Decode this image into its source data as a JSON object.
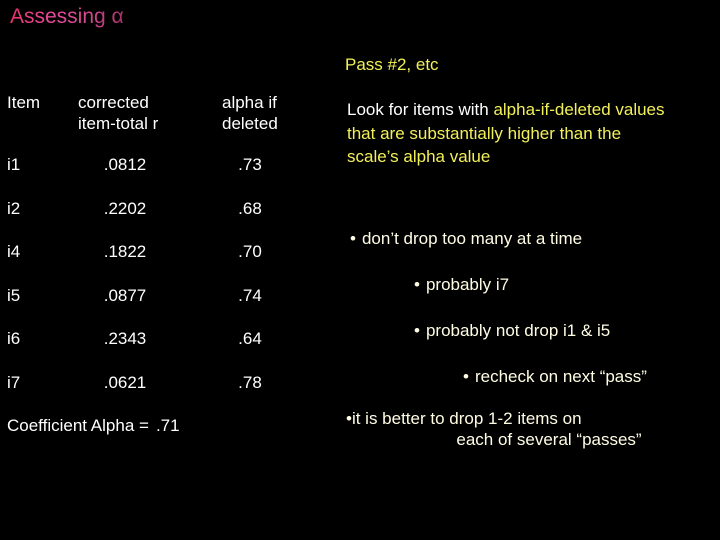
{
  "slide": {
    "background_color": "#000000",
    "title": "Assessing α",
    "title_gradient": [
      "#e8316e",
      "#e8499a",
      "#d64a92",
      "#a8336b"
    ]
  },
  "table": {
    "headers": {
      "item": "Item",
      "corrected_line1": "corrected",
      "corrected_line2": "item-total r",
      "alpha_line1": "alpha if",
      "alpha_line2": "deleted"
    },
    "rows": [
      {
        "item": "i1",
        "corrected": ".0812",
        "alpha_if_deleted": ".73"
      },
      {
        "item": "i2",
        "corrected": ".2202",
        "alpha_if_deleted": ".68"
      },
      {
        "item": "i4",
        "corrected": ".1822",
        "alpha_if_deleted": ".70"
      },
      {
        "item": "i5",
        "corrected": ".0877",
        "alpha_if_deleted": ".74"
      },
      {
        "item": "i6",
        "corrected": ".2343",
        "alpha_if_deleted": ".64"
      },
      {
        "item": "i7",
        "corrected": ".0621",
        "alpha_if_deleted": ".78"
      }
    ],
    "footer_label": "Coefficient Alpha =",
    "footer_value": ".71",
    "text_color": "#ffffff"
  },
  "right_panel": {
    "heading": "Pass #2, etc",
    "heading_color": "#f2f05a",
    "paragraph_lead": "Look for items with ",
    "paragraph_emphasis": "alpha-if-deleted values that are substantially higher than the scale’s alpha value",
    "paragraph_lead_color": "#ffffff",
    "paragraph_emphasis_color": "#f2f05a",
    "bullet_color": "#fffde4",
    "bullets": [
      {
        "marker": "•",
        "text": "don’t drop too many at a time",
        "level": 1
      },
      {
        "marker": "•",
        "text": "probably i7",
        "level": 2
      },
      {
        "marker": "•",
        "text": "probably not drop i1 & i5",
        "level": 2
      },
      {
        "marker": "•",
        "text": "recheck on next “pass”",
        "level": 3
      },
      {
        "marker": "•",
        "text_line1": "it is better to drop 1-2 items on",
        "text_line2": "each of several “passes”",
        "level": 1
      }
    ]
  }
}
